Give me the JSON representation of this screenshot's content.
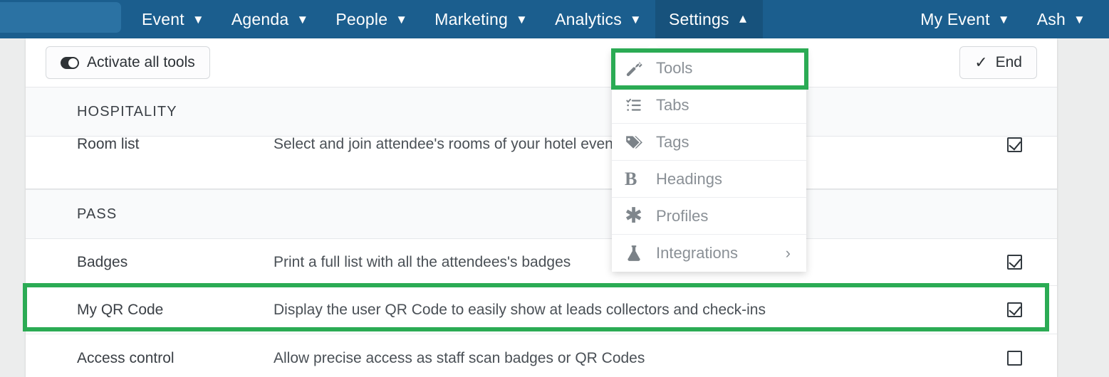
{
  "topnav": {
    "brand": "",
    "items": [
      {
        "label": "Event",
        "caret": "chevron-down",
        "active": false
      },
      {
        "label": "Agenda",
        "caret": "chevron-down",
        "active": false
      },
      {
        "label": "People",
        "caret": "chevron-down",
        "active": false
      },
      {
        "label": "Marketing",
        "caret": "chevron-down",
        "active": false
      },
      {
        "label": "Analytics",
        "caret": "chevron-down",
        "active": false
      },
      {
        "label": "Settings",
        "caret": "chevron-up",
        "active": true
      }
    ],
    "right": [
      {
        "label": "My Event",
        "caret": "chevron-down"
      },
      {
        "label": "Ash",
        "caret": "chevron-down"
      }
    ],
    "bg_color": "#1b5e8e",
    "active_bg_color": "#17527c"
  },
  "toolbar": {
    "activate_all_label": "Activate all tools",
    "end_label": "End"
  },
  "dropdown": {
    "items": [
      {
        "label": "Tools",
        "icon": "wrench-icon",
        "has_submenu": false,
        "highlighted": true
      },
      {
        "label": "Tabs",
        "icon": "list-check-icon",
        "has_submenu": false,
        "highlighted": false
      },
      {
        "label": "Tags",
        "icon": "tag-icon",
        "has_submenu": false,
        "highlighted": false
      },
      {
        "label": "Headings",
        "icon": "bold-b-icon",
        "has_submenu": false,
        "highlighted": false
      },
      {
        "label": "Profiles",
        "icon": "asterisk-icon",
        "has_submenu": false,
        "highlighted": false
      },
      {
        "label": "Integrations",
        "icon": "flask-icon",
        "has_submenu": true,
        "highlighted": false,
        "chevron": "›"
      }
    ]
  },
  "list": {
    "sections": [
      {
        "title": "HOSPITALITY",
        "rows": [
          {
            "name": "Room list",
            "desc": "Select and join attendee's rooms of your hotel event",
            "checked": true,
            "clipped": true
          }
        ]
      },
      {
        "title": "PASS",
        "rows": [
          {
            "name": "Badges",
            "desc": "Print a full list with all the attendees's badges",
            "checked": true,
            "clipped": false
          },
          {
            "name": "My QR Code",
            "desc": "Display the user QR Code to easily show at leads collectors and check-ins",
            "checked": true,
            "clipped": false
          },
          {
            "name": "Access control",
            "desc": "Allow precise access as staff scan badges or QR Codes",
            "checked": false,
            "clipped": false
          }
        ]
      }
    ]
  },
  "annotations": {
    "highlight_color": "#2bab54",
    "boxes": [
      {
        "target": "Tools menu item"
      },
      {
        "target": "My QR Code row"
      }
    ]
  }
}
